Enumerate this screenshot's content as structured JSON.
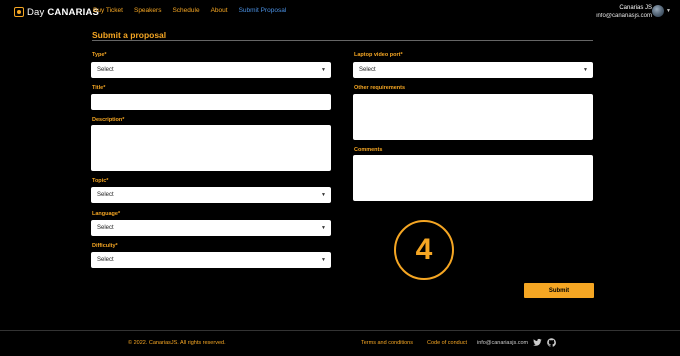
{
  "header": {
    "logo_prefix": "Day",
    "logo_name": "CANARIAS",
    "nav": [
      "Buy Ticket",
      "Speakers",
      "Schedule",
      "About",
      "Submit Proposal"
    ],
    "user_name": "Canarias JS",
    "user_email": "info@canariasjs.com"
  },
  "form": {
    "title": "Submit a proposal",
    "type_label": "Type*",
    "type_value": "Select",
    "title_label": "Title*",
    "description_label": "Description*",
    "topic_label": "Topic*",
    "topic_value": "Select",
    "language_label": "Language*",
    "language_value": "Select",
    "difficulty_label": "Difficulty*",
    "difficulty_value": "Select",
    "laptop_label": "Laptop video port*",
    "laptop_value": "Select",
    "other_label": "Other requirements",
    "comments_label": "Comments",
    "step_number": "4",
    "submit_label": "Submit"
  },
  "footer": {
    "copyright": "© 2022. CanariasJS. All rights reserved.",
    "terms": "Terms and conditions",
    "conduct": "Code of conduct",
    "email": "info@canariasjs.com"
  },
  "colors": {
    "accent": "#f5a623",
    "active_link": "#4a90e2",
    "background": "#000000"
  },
  "icons": [
    "twitter-icon",
    "github-icon",
    "chevron-down-icon"
  ]
}
